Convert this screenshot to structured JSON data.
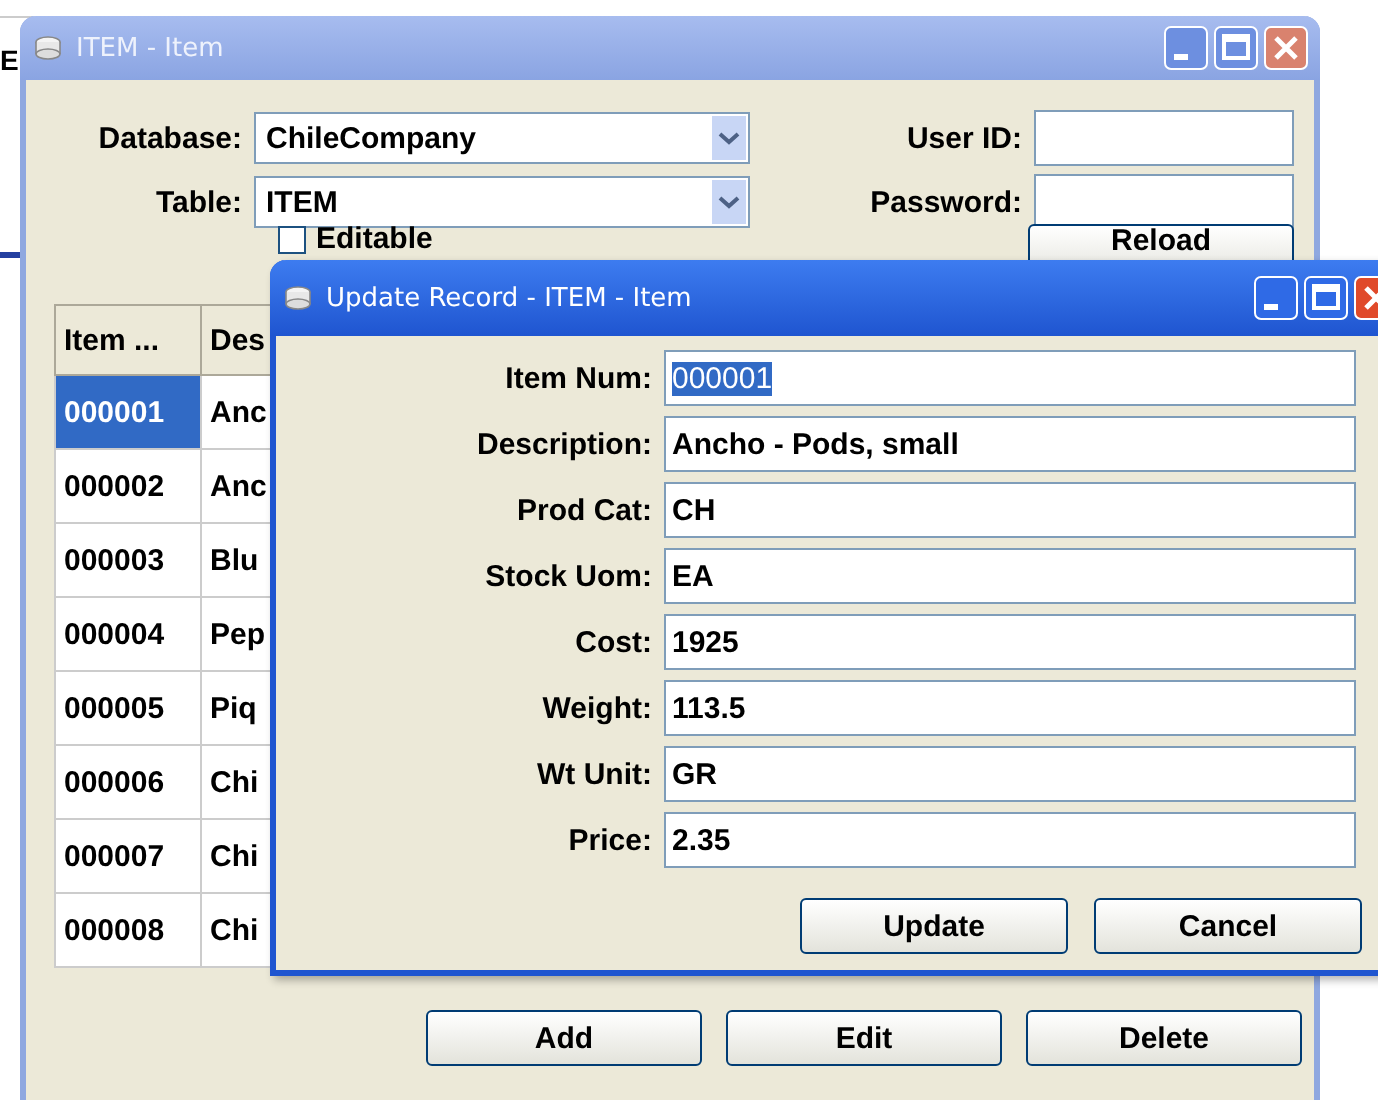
{
  "background": {
    "text": "E"
  },
  "window": {
    "title": "ITEM - Item",
    "selects": [
      {
        "label": "Database:",
        "value": "ChileCompany"
      },
      {
        "label": "Table:",
        "value": "ITEM"
      }
    ],
    "credentials": [
      {
        "label": "User ID:"
      },
      {
        "label": "Password:"
      }
    ],
    "editable": {
      "label": "Editable",
      "checked": false
    },
    "reload": "Reload",
    "table": {
      "columns": [
        "Item ...",
        "Des"
      ],
      "rows": [
        {
          "cells": [
            "000001",
            "Anc"
          ],
          "selected": true
        },
        {
          "cells": [
            "000002",
            "Anc"
          ],
          "selected": false
        },
        {
          "cells": [
            "000003",
            "Blu"
          ],
          "selected": false
        },
        {
          "cells": [
            "000004",
            "Pep"
          ],
          "selected": false
        },
        {
          "cells": [
            "000005",
            "Piq"
          ],
          "selected": false
        },
        {
          "cells": [
            "000006",
            "Chi"
          ],
          "selected": false
        },
        {
          "cells": [
            "000007",
            "Chi"
          ],
          "selected": false
        },
        {
          "cells": [
            "000008",
            "Chi"
          ],
          "selected": false
        }
      ]
    },
    "buttons": [
      "Add",
      "Edit",
      "Delete"
    ]
  },
  "dialog": {
    "title": "Update Record - ITEM - Item",
    "fields": [
      {
        "label": "Item Num:",
        "value": "000001",
        "text_selected": true
      },
      {
        "label": "Description:",
        "value": "Ancho - Pods, small",
        "text_selected": false
      },
      {
        "label": "Prod Cat:",
        "value": "CH",
        "text_selected": false
      },
      {
        "label": "Stock Uom:",
        "value": "EA",
        "text_selected": false
      },
      {
        "label": "Cost:",
        "value": "1925",
        "text_selected": false
      },
      {
        "label": "Weight:",
        "value": "113.5",
        "text_selected": false
      },
      {
        "label": "Wt Unit:",
        "value": "GR",
        "text_selected": false
      },
      {
        "label": "Price:",
        "value": "2.35",
        "text_selected": false
      }
    ],
    "buttons": [
      "Update",
      "Cancel"
    ]
  }
}
